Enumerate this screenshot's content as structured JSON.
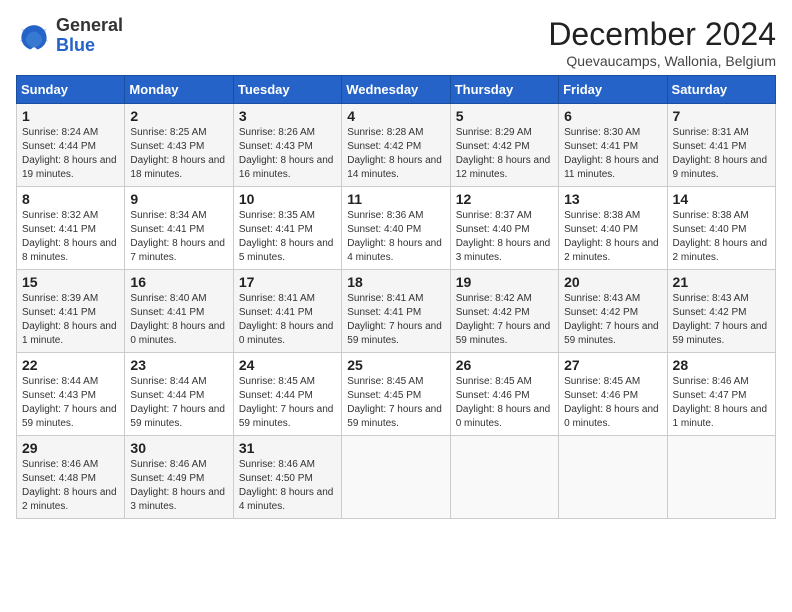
{
  "logo": {
    "general": "General",
    "blue": "Blue"
  },
  "header": {
    "month": "December 2024",
    "location": "Quevaucamps, Wallonia, Belgium"
  },
  "days_of_week": [
    "Sunday",
    "Monday",
    "Tuesday",
    "Wednesday",
    "Thursday",
    "Friday",
    "Saturday"
  ],
  "weeks": [
    [
      {
        "day": "1",
        "sunrise": "8:24 AM",
        "sunset": "4:44 PM",
        "daylight": "8 hours and 19 minutes."
      },
      {
        "day": "2",
        "sunrise": "8:25 AM",
        "sunset": "4:43 PM",
        "daylight": "8 hours and 18 minutes."
      },
      {
        "day": "3",
        "sunrise": "8:26 AM",
        "sunset": "4:43 PM",
        "daylight": "8 hours and 16 minutes."
      },
      {
        "day": "4",
        "sunrise": "8:28 AM",
        "sunset": "4:42 PM",
        "daylight": "8 hours and 14 minutes."
      },
      {
        "day": "5",
        "sunrise": "8:29 AM",
        "sunset": "4:42 PM",
        "daylight": "8 hours and 12 minutes."
      },
      {
        "day": "6",
        "sunrise": "8:30 AM",
        "sunset": "4:41 PM",
        "daylight": "8 hours and 11 minutes."
      },
      {
        "day": "7",
        "sunrise": "8:31 AM",
        "sunset": "4:41 PM",
        "daylight": "8 hours and 9 minutes."
      }
    ],
    [
      {
        "day": "8",
        "sunrise": "8:32 AM",
        "sunset": "4:41 PM",
        "daylight": "8 hours and 8 minutes."
      },
      {
        "day": "9",
        "sunrise": "8:34 AM",
        "sunset": "4:41 PM",
        "daylight": "8 hours and 7 minutes."
      },
      {
        "day": "10",
        "sunrise": "8:35 AM",
        "sunset": "4:41 PM",
        "daylight": "8 hours and 5 minutes."
      },
      {
        "day": "11",
        "sunrise": "8:36 AM",
        "sunset": "4:40 PM",
        "daylight": "8 hours and 4 minutes."
      },
      {
        "day": "12",
        "sunrise": "8:37 AM",
        "sunset": "4:40 PM",
        "daylight": "8 hours and 3 minutes."
      },
      {
        "day": "13",
        "sunrise": "8:38 AM",
        "sunset": "4:40 PM",
        "daylight": "8 hours and 2 minutes."
      },
      {
        "day": "14",
        "sunrise": "8:38 AM",
        "sunset": "4:40 PM",
        "daylight": "8 hours and 2 minutes."
      }
    ],
    [
      {
        "day": "15",
        "sunrise": "8:39 AM",
        "sunset": "4:41 PM",
        "daylight": "8 hours and 1 minute."
      },
      {
        "day": "16",
        "sunrise": "8:40 AM",
        "sunset": "4:41 PM",
        "daylight": "8 hours and 0 minutes."
      },
      {
        "day": "17",
        "sunrise": "8:41 AM",
        "sunset": "4:41 PM",
        "daylight": "8 hours and 0 minutes."
      },
      {
        "day": "18",
        "sunrise": "8:41 AM",
        "sunset": "4:41 PM",
        "daylight": "7 hours and 59 minutes."
      },
      {
        "day": "19",
        "sunrise": "8:42 AM",
        "sunset": "4:42 PM",
        "daylight": "7 hours and 59 minutes."
      },
      {
        "day": "20",
        "sunrise": "8:43 AM",
        "sunset": "4:42 PM",
        "daylight": "7 hours and 59 minutes."
      },
      {
        "day": "21",
        "sunrise": "8:43 AM",
        "sunset": "4:42 PM",
        "daylight": "7 hours and 59 minutes."
      }
    ],
    [
      {
        "day": "22",
        "sunrise": "8:44 AM",
        "sunset": "4:43 PM",
        "daylight": "7 hours and 59 minutes."
      },
      {
        "day": "23",
        "sunrise": "8:44 AM",
        "sunset": "4:44 PM",
        "daylight": "7 hours and 59 minutes."
      },
      {
        "day": "24",
        "sunrise": "8:45 AM",
        "sunset": "4:44 PM",
        "daylight": "7 hours and 59 minutes."
      },
      {
        "day": "25",
        "sunrise": "8:45 AM",
        "sunset": "4:45 PM",
        "daylight": "7 hours and 59 minutes."
      },
      {
        "day": "26",
        "sunrise": "8:45 AM",
        "sunset": "4:46 PM",
        "daylight": "8 hours and 0 minutes."
      },
      {
        "day": "27",
        "sunrise": "8:45 AM",
        "sunset": "4:46 PM",
        "daylight": "8 hours and 0 minutes."
      },
      {
        "day": "28",
        "sunrise": "8:46 AM",
        "sunset": "4:47 PM",
        "daylight": "8 hours and 1 minute."
      }
    ],
    [
      {
        "day": "29",
        "sunrise": "8:46 AM",
        "sunset": "4:48 PM",
        "daylight": "8 hours and 2 minutes."
      },
      {
        "day": "30",
        "sunrise": "8:46 AM",
        "sunset": "4:49 PM",
        "daylight": "8 hours and 3 minutes."
      },
      {
        "day": "31",
        "sunrise": "8:46 AM",
        "sunset": "4:50 PM",
        "daylight": "8 hours and 4 minutes."
      },
      null,
      null,
      null,
      null
    ]
  ],
  "labels": {
    "sunrise": "Sunrise:",
    "sunset": "Sunset:",
    "daylight": "Daylight:"
  }
}
